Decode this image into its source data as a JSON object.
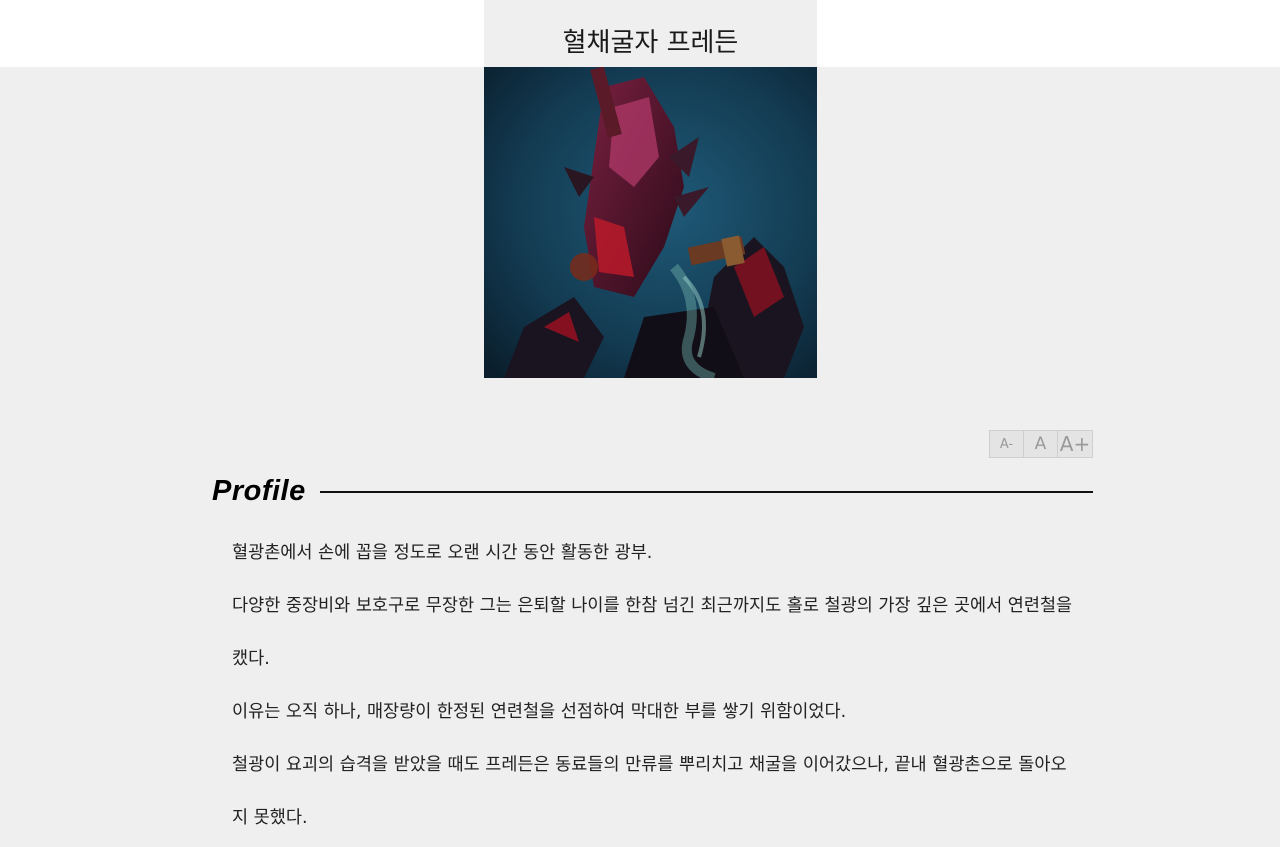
{
  "header": {
    "title": "혈채굴자 프레든"
  },
  "font_controls": {
    "decrease_label": "A-",
    "normal_label": "A",
    "increase_label": "A+"
  },
  "profile": {
    "heading": "Profile",
    "paragraphs": [
      "혈광촌에서 손에 꼽을 정도로 오랜 시간 동안 활동한 광부.",
      "다양한 중장비와 보호구로 무장한 그는 은퇴할 나이를 한참 넘긴 최근까지도 홀로 철광의 가장 깊은 곳에서 연련철을 캤다.",
      "이유는 오직 하나, 매장량이 한정된 연련철을 선점하여 막대한 부를 쌓기 위함이었다.",
      "철광이 요괴의 습격을 받았을 때도 프레든은 동료들의 만류를 뿌리치고 채굴을 이어갔으나, 끝내 혈광촌으로 돌아오지 못했다."
    ]
  }
}
